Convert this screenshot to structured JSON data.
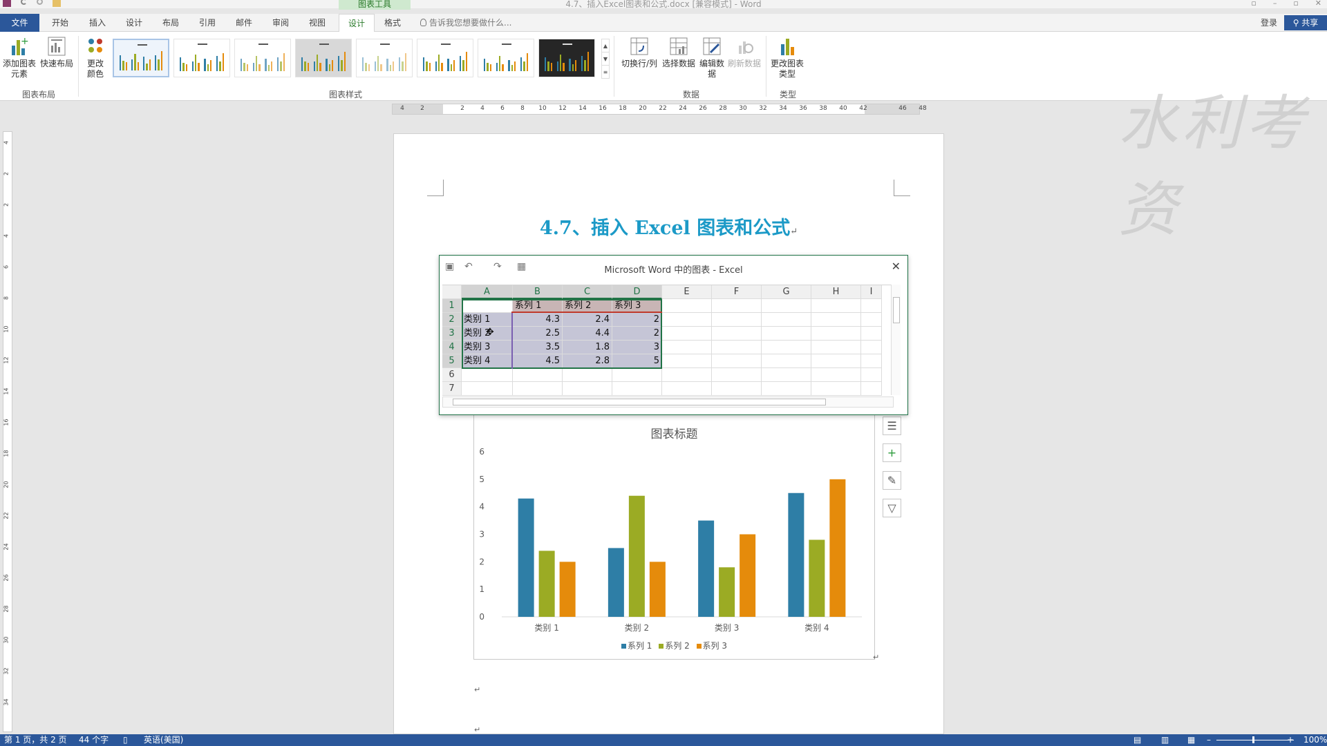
{
  "window": {
    "doc_title": "4.7、插入Excel图表和公式.docx [兼容模式] - Word",
    "context_tab_header": "图表工具"
  },
  "tabs": {
    "file": "文件",
    "items": [
      "开始",
      "插入",
      "设计",
      "布局",
      "引用",
      "邮件",
      "审阅",
      "视图",
      "设计",
      "格式"
    ],
    "active_index": 8,
    "tell_me": "告诉我您想要做什么...",
    "login": "登录",
    "share": "共享"
  },
  "ribbon": {
    "add_element": "添加图表元素",
    "quick_layout": "快速布局",
    "change_color": "更改颜色",
    "switch_row_col": "切换行/列",
    "select_data": "选择数据",
    "edit_data": "编辑数据",
    "refresh_data": "刷新数据",
    "change_type": "更改图表类型",
    "groups": {
      "layout": "图表布局",
      "styles": "图表样式",
      "data": "数据",
      "type": "类型"
    }
  },
  "ruler": {
    "h_ticks": [
      "4",
      "2",
      "2",
      "4",
      "6",
      "8",
      "10",
      "12",
      "14",
      "16",
      "18",
      "20",
      "22",
      "24",
      "26",
      "28",
      "30",
      "32",
      "34",
      "36",
      "38",
      "40",
      "42",
      "46",
      "48"
    ],
    "v_ticks": [
      "4",
      "2",
      "2",
      "4",
      "6",
      "8",
      "10",
      "12",
      "14",
      "16",
      "18",
      "20",
      "22",
      "24",
      "26",
      "28",
      "30",
      "32",
      "34"
    ]
  },
  "document": {
    "heading": "4.7、插入 Excel 图表和公式",
    "pilcrow": "↵"
  },
  "excel": {
    "title": "Microsoft Word 中的图表 - Excel",
    "close": "✕",
    "columns": [
      "A",
      "B",
      "C",
      "D",
      "E",
      "F",
      "G",
      "H",
      "I"
    ],
    "rows": [
      "1",
      "2",
      "3",
      "4",
      "5",
      "6",
      "7"
    ],
    "cells": [
      [
        "",
        "系列 1",
        "系列 2",
        "系列 3"
      ],
      [
        "类别 1",
        "4.3",
        "2.4",
        "2"
      ],
      [
        "类别 2",
        "2.5",
        "4.4",
        "2"
      ],
      [
        "类别 3",
        "3.5",
        "1.8",
        "3"
      ],
      [
        "类别 4",
        "4.5",
        "2.8",
        "5"
      ]
    ]
  },
  "colors": {
    "accent": "#2b579a",
    "series1": "#2e7ea6",
    "series2": "#9bab24",
    "series3": "#e58b0b",
    "heading": "#1c9ac7"
  },
  "chart_data": {
    "type": "bar",
    "title": "图表标题",
    "categories": [
      "类别 1",
      "类别 2",
      "类别 3",
      "类别 4"
    ],
    "series": [
      {
        "name": "系列 1",
        "values": [
          4.3,
          2.5,
          3.5,
          4.5
        ]
      },
      {
        "name": "系列 2",
        "values": [
          2.4,
          4.4,
          1.8,
          2.8
        ]
      },
      {
        "name": "系列 3",
        "values": [
          2,
          2,
          3,
          5
        ]
      }
    ],
    "ylim": [
      0,
      6
    ],
    "yticks": [
      "0",
      "1",
      "2",
      "3",
      "4",
      "5",
      "6"
    ],
    "legend": "bottom",
    "grid": false
  },
  "watermark": "水利考资",
  "status": {
    "page": "第 1 页，共 2 页",
    "words": "44 个字",
    "language": "英语(美国)",
    "zoom": "100%"
  }
}
